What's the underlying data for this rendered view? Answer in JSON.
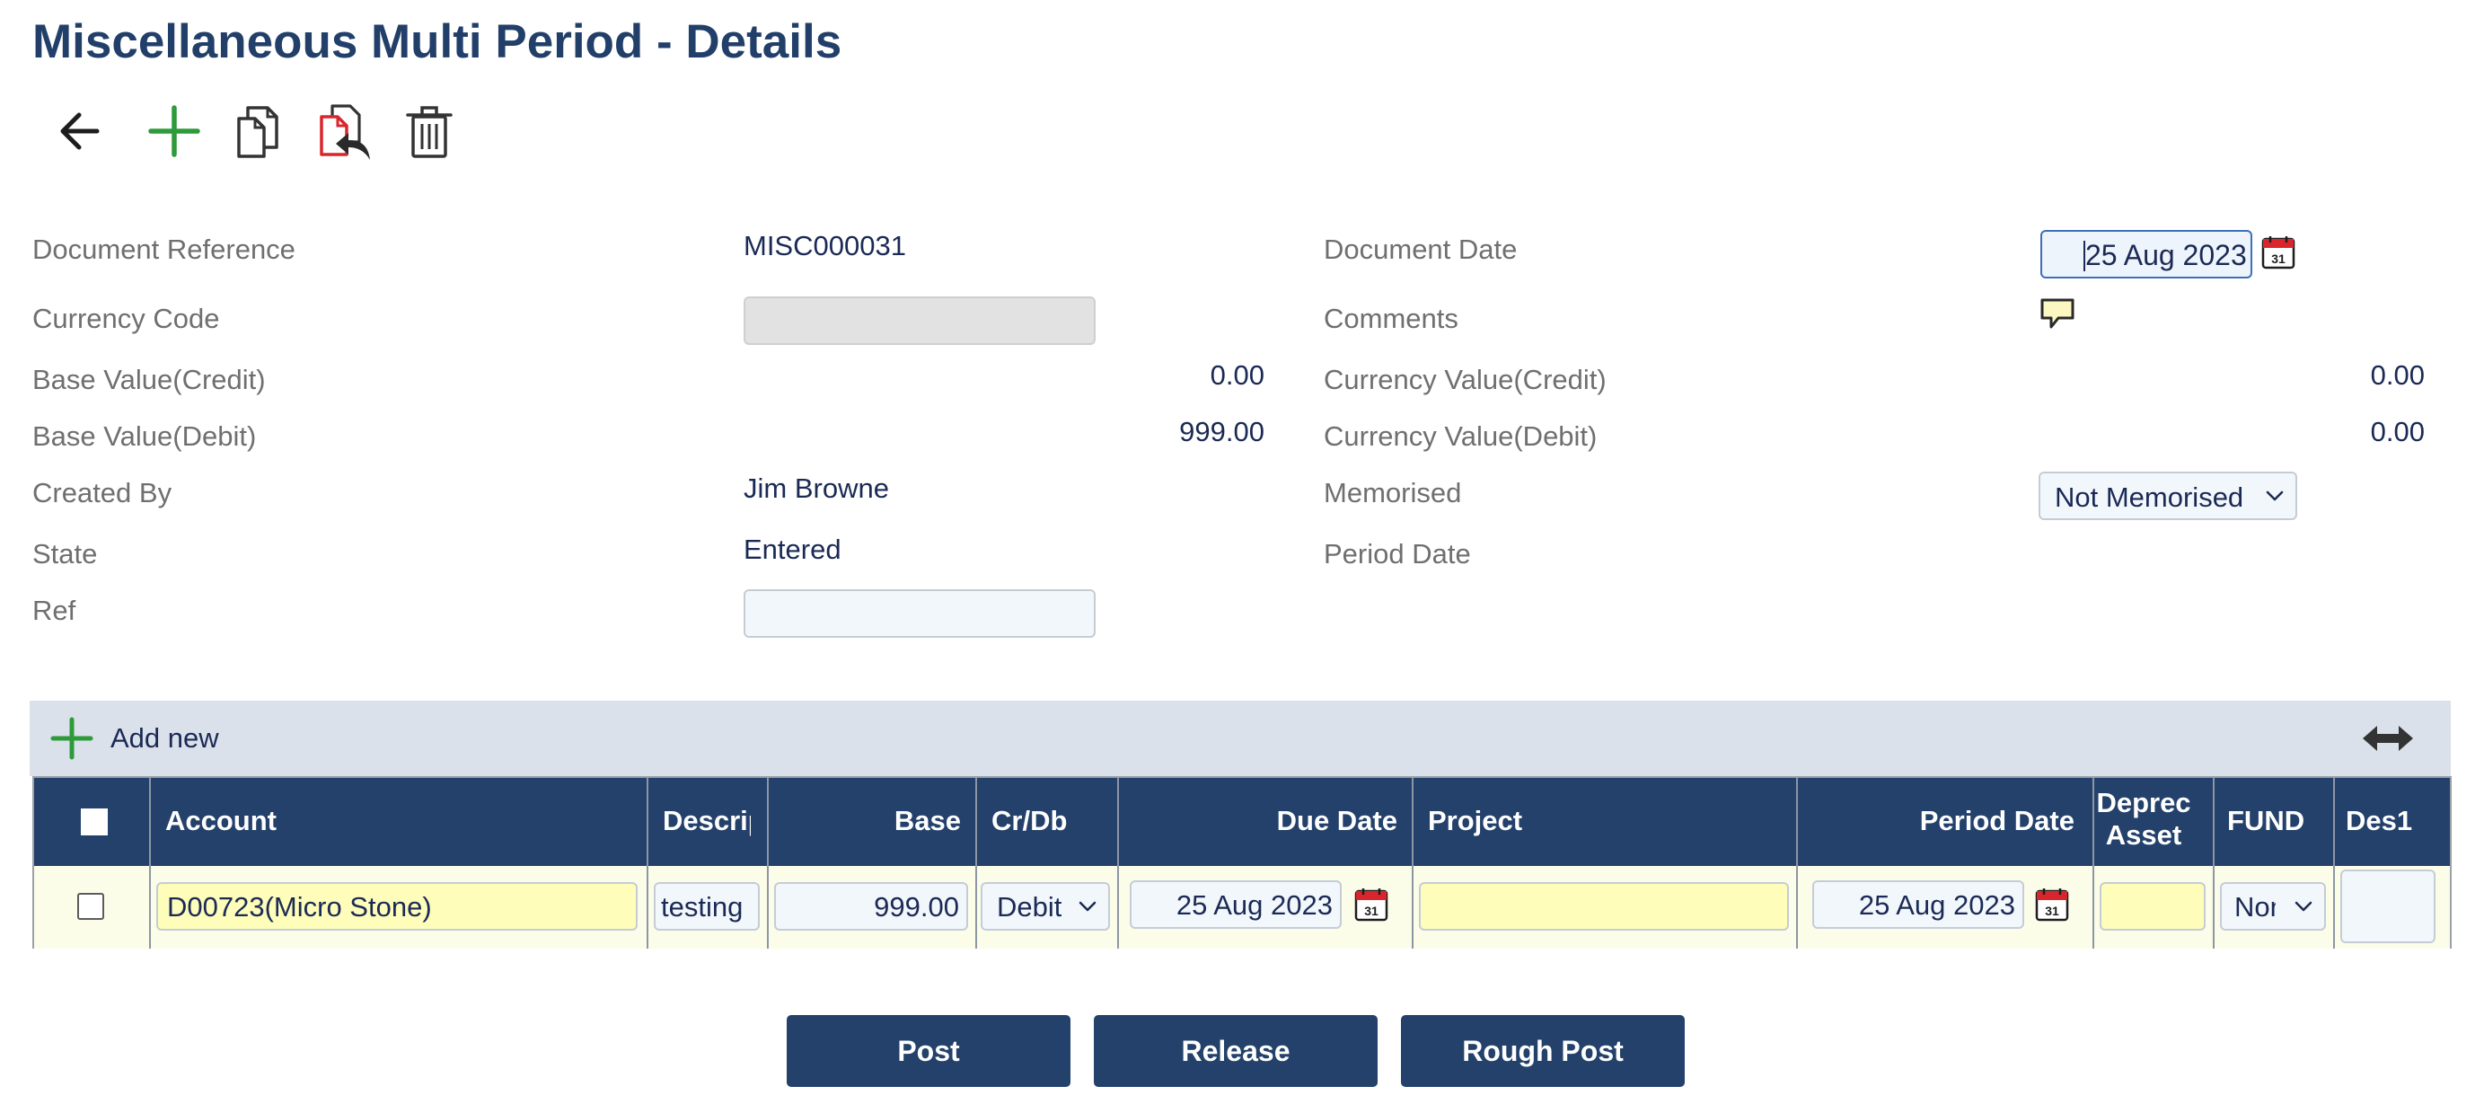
{
  "page": {
    "title": "Miscellaneous Multi Period - Details"
  },
  "toolbar": {
    "back_icon": "arrow-left-icon",
    "add_icon": "plus-icon",
    "copy_icon": "copy-icon",
    "reverse_icon": "document-reverse-icon",
    "delete_icon": "trash-icon"
  },
  "form": {
    "document_reference": {
      "label": "Document Reference",
      "value": "MISC000031"
    },
    "currency_code": {
      "label": "Currency Code",
      "value": ""
    },
    "base_value_credit": {
      "label": "Base Value(Credit)",
      "value": "0.00"
    },
    "base_value_debit": {
      "label": "Base Value(Debit)",
      "value": "999.00"
    },
    "created_by": {
      "label": "Created By",
      "value": "Jim Browne"
    },
    "state": {
      "label": "State",
      "value": "Entered"
    },
    "ref": {
      "label": "Ref",
      "value": ""
    },
    "document_date": {
      "label": "Document Date",
      "value": "25 Aug 2023"
    },
    "comments": {
      "label": "Comments"
    },
    "currency_value_credit": {
      "label": "Currency Value(Credit)",
      "value": "0.00"
    },
    "currency_value_debit": {
      "label": "Currency Value(Debit)",
      "value": "0.00"
    },
    "memorised": {
      "label": "Memorised",
      "value": "Not Memorised"
    },
    "period_date": {
      "label": "Period Date",
      "value": ""
    }
  },
  "grid": {
    "add_new_label": "Add new",
    "columns": {
      "account": "Account",
      "description": "Description",
      "base": "Base",
      "crdb": "Cr/Db",
      "due_date": "Due Date",
      "project": "Project",
      "period_date": "Period Date",
      "deprec_asset_line1": "Deprec",
      "deprec_asset_line2": "Asset",
      "fund": "FUND",
      "des1": "Des1"
    },
    "rows": [
      {
        "account": "D00723(Micro Stone)",
        "description": "testing",
        "base": "999.00",
        "crdb": "Debit",
        "due_date": "25 Aug 2023",
        "project": "",
        "period_date": "25 Aug 2023",
        "deprec_asset": "",
        "fund": "None",
        "des1": ""
      }
    ]
  },
  "buttons": {
    "post": "Post",
    "release": "Release",
    "rough_post": "Rough Post"
  },
  "colors": {
    "header_navy": "#23416b",
    "title_navy": "#223f6a",
    "add_green": "#2e9a3a",
    "required_yellow": "#fefdb9",
    "reverse_red": "#d9262c"
  }
}
